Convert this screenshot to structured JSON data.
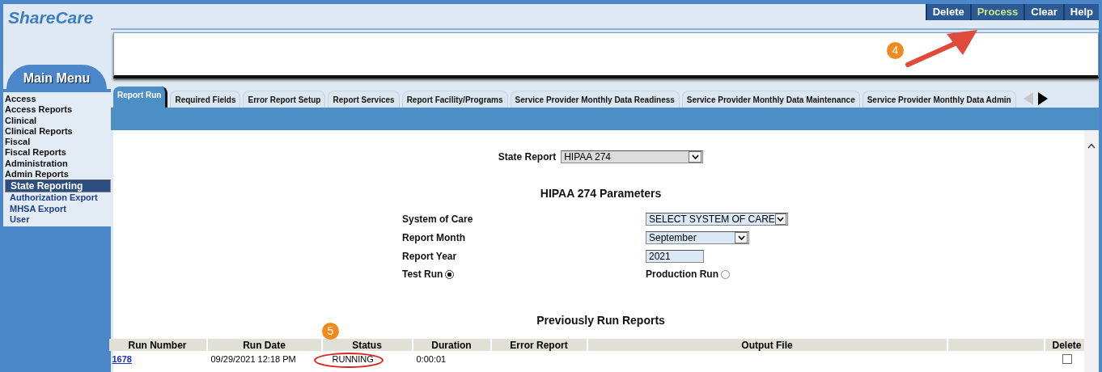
{
  "logo": {
    "bold": "Share",
    "rest": "Care"
  },
  "toolbar": [
    {
      "label": "Delete",
      "selected": false
    },
    {
      "label": "Process",
      "selected": true
    },
    {
      "label": "Clear",
      "selected": false
    },
    {
      "label": "Help",
      "selected": false
    }
  ],
  "sidebar": {
    "title": "Main Menu",
    "items": [
      {
        "label": "Access",
        "selected": false
      },
      {
        "label": "Access Reports",
        "selected": false
      },
      {
        "label": "Clinical",
        "selected": false
      },
      {
        "label": "Clinical Reports",
        "selected": false
      },
      {
        "label": "Fiscal",
        "selected": false
      },
      {
        "label": "Fiscal Reports",
        "selected": false
      },
      {
        "label": "Administration",
        "selected": false
      },
      {
        "label": "Admin Reports",
        "selected": false,
        "children": [
          {
            "label": "State Reporting",
            "selected": true
          },
          {
            "label": "Authorization Export",
            "selected": false
          },
          {
            "label": "MHSA Export",
            "selected": false
          },
          {
            "label": "User",
            "selected": false
          }
        ]
      }
    ]
  },
  "tabs": [
    {
      "label": "Report Run",
      "selected": true
    },
    {
      "label": "Required Fields",
      "selected": false
    },
    {
      "label": "Error Report Setup",
      "selected": false
    },
    {
      "label": "Report Services",
      "selected": false
    },
    {
      "label": "Report Facility/Programs",
      "selected": false
    },
    {
      "label": "Service Provider Monthly Data Readiness",
      "selected": false
    },
    {
      "label": "Service Provider Monthly Data Maintenance",
      "selected": false
    },
    {
      "label": "Service Provider Monthly Data Admin",
      "selected": false
    }
  ],
  "state_report": {
    "label": "State Report",
    "value": "HIPAA 274"
  },
  "parameters": {
    "title": "HIPAA 274 Parameters",
    "rows": [
      {
        "label": "System of Care",
        "kind": "select",
        "value": "SELECT SYSTEM OF CARE"
      },
      {
        "label": "Report Month",
        "kind": "select",
        "value": "September"
      },
      {
        "label": "Report Year",
        "kind": "text",
        "value": "2021"
      }
    ],
    "run_modes": [
      {
        "label": "Test Run",
        "selected": true
      },
      {
        "label": "Production Run",
        "selected": false
      }
    ]
  },
  "reports": {
    "title": "Previously Run Reports",
    "columns": [
      "Run Number",
      "Run Date",
      "Status",
      "Duration",
      "Error Report",
      "Output File",
      "",
      "Delete"
    ],
    "rows": [
      {
        "run_number": "1678",
        "run_date": "09/29/2021 12:18 PM",
        "status": "RUNNING",
        "duration": "0:00:01",
        "delete_checked": false
      }
    ]
  },
  "annotations": [
    {
      "label": "4"
    },
    {
      "label": "5"
    }
  ]
}
